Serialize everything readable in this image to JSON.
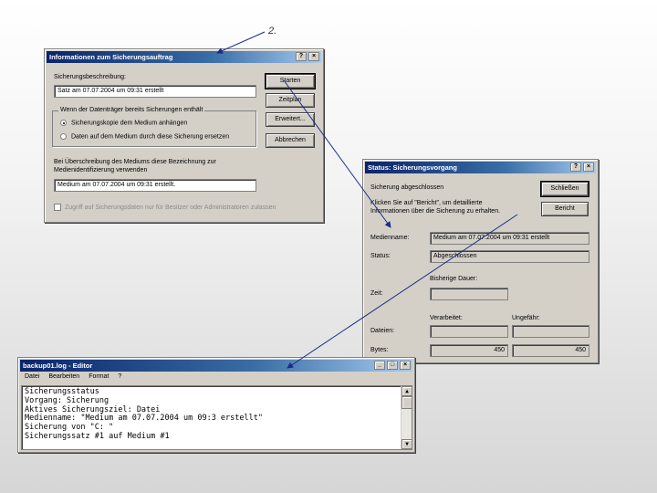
{
  "step_label": "2.",
  "dialog_info": {
    "title": "Informationen zum Sicherungsauftrag",
    "help_btn": "?",
    "close_btn": "×",
    "desc_label": "Sicherungsbeschreibung:",
    "desc_value": "Satz am 07.07.2004 um 09:31 erstellt",
    "group_label": "Wenn der Datenträger bereits Sicherungen enthält",
    "radio_append": "Sicherungskopie dem Medium anhängen",
    "radio_replace": "Daten auf dem Medium durch diese Sicherung ersetzen",
    "medium_label_line1": "Bei Überschreibung des Mediums diese Bezeichnung zur",
    "medium_label_line2": "Medienidentifizierung verwenden",
    "medium_value": "Medium am 07.07.2004 um 09:31 erstellt.",
    "checkbox_label": "Zugriff auf Sicherungsdaten nur für Besitzer oder Administratoren zulassen",
    "btn_start": "Starten",
    "btn_schedule": "Zeitplan",
    "btn_advanced": "Erweitert...",
    "btn_cancel": "Abbrechen"
  },
  "dialog_status": {
    "title": "Status: Sicherungsvorgang",
    "help_btn": "?",
    "close_btn": "×",
    "status_text": "Sicherung abgeschlossen",
    "btn_close": "Schließen",
    "btn_report": "Bericht",
    "info_line1": "Klicken Sie auf \"Bericht\", um detaillierte",
    "info_line2": "Informationen über die Sicherung zu erhalten.",
    "medium_label": "Medienname:",
    "medium_value": "Medium am 07.07.2004 um 09:31 erstellt",
    "status_label": "Status:",
    "status_value": "Abgeschlossen",
    "elapsed_header": "Bisherige Dauer:",
    "time_label": "Zeit:",
    "processed_header": "Verarbeitet:",
    "estimated_header": "Ungefähr:",
    "files_label": "Dateien:",
    "bytes_label": "Bytes:",
    "bytes_processed": "450",
    "bytes_estimated": "450"
  },
  "editor": {
    "title": "backup01.log - Editor",
    "btn_min": "_",
    "btn_max": "□",
    "btn_close": "×",
    "menu": [
      "Datei",
      "Bearbeiten",
      "Format",
      "?"
    ],
    "lines": [
      "Sicherungsstatus",
      "Vorgang: Sicherung",
      "Aktives Sicherungsziel: Datei",
      "Medienname: \"Medium am 07.07.2004 um 09:3 erstellt\"",
      "Sicherung von \"C: \"",
      "Sicherungssatz #1 auf Medium #1"
    ],
    "scroll_up": "▲",
    "scroll_down": "▼"
  }
}
